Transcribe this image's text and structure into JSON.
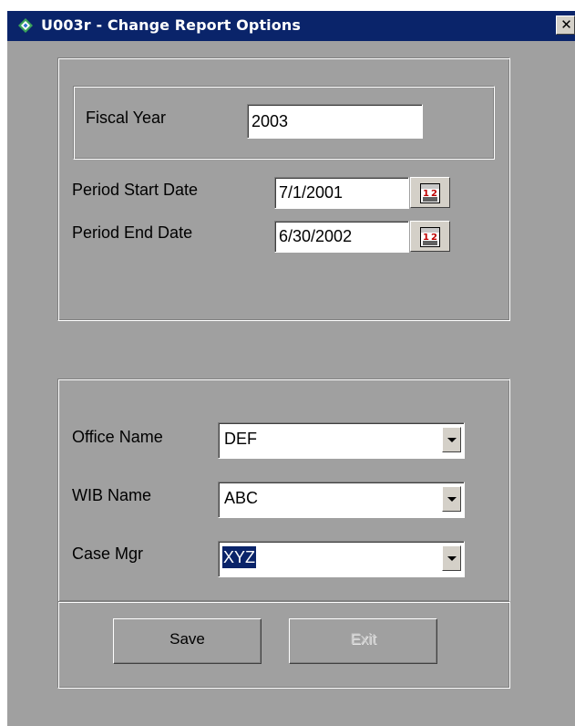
{
  "window": {
    "title": "U003r - Change Report Options",
    "close_label": "✕",
    "app_icon": "diamond-app-icon"
  },
  "colors": {
    "titlebar": "#0a246a",
    "background": "#a0a0a0",
    "selection": "#0a246a"
  },
  "dates": {
    "fiscal_year_label": "Fiscal Year",
    "fiscal_year_value": "2003",
    "period_start_label": "Period Start Date",
    "period_start_value": "7/1/2001",
    "period_end_label": "Period End Date",
    "period_end_value": "6/30/2002",
    "calendar_icon": "calendar-icon"
  },
  "filters": {
    "office_label": "Office Name",
    "office_value": "DEF",
    "wib_label": "WIB Name",
    "wib_value": "ABC",
    "case_mgr_label": "Case Mgr",
    "case_mgr_value": "XYZ"
  },
  "buttons": {
    "save_label": "Save",
    "exit_label": "Exit"
  }
}
